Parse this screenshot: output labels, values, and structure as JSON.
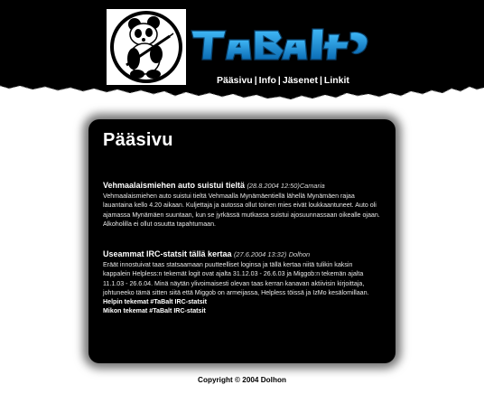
{
  "header": {
    "logo_text": "TaBalt",
    "nav": [
      {
        "label": "Pääsivu"
      },
      {
        "label": "Info"
      },
      {
        "label": "Jäsenet"
      },
      {
        "label": "Linkit"
      }
    ],
    "separator": "|"
  },
  "main": {
    "title": "Pääsivu",
    "posts": [
      {
        "title": "Vehmaalaismiehen auto suistui tieltä",
        "meta": "(28.8.2004 12:50)",
        "author": "Camaria",
        "body": "Vehmaalaismiehen auto suistui tieltä Vehmaalla Mynämäentiellä lähellä Mynämäen rajaa lauantaina kello 4.20 aikaan. Kuljettaja ja autossa ollut toinen mies eivät loukkaantuneet. Auto oli ajamassa Mynämäen suuntaan, kun se jyrkässä mutkassa suistui ajosuunnassaan oikealle ojaan. Alkoholilla ei ollut osuutta tapahtumaan.",
        "links": []
      },
      {
        "title": "Useammat IRC-statsit tällä kertaa",
        "meta": "(27.6.2004 13:32)",
        "author": "Dolhon",
        "body": "Eräät innostuivat taas statsaamaan puutteelliset loginsa ja tällä kertaa niitä tulikin kaksin kappalein Helpless:n tekemät logit ovat ajalta 31.12.03 - 26.6.03 ja Miggob:n tekemän ajalta 11.1.03 - 26.6.04. Minä näytän ylivoimaisesti olevan taas kerran kanavan aktiivisin kirjoittaja, johtuneeko tämä sitten siitä että Miggob on armeijassa, Helpless töissä ja IzMo kesälomillaan.",
        "links": [
          {
            "label": "Helpin tekemat #TaBalt IRC-statsit"
          },
          {
            "label": "Mikon tekemat #TaBalt IRC-statsit"
          }
        ]
      }
    ]
  },
  "footer": {
    "copyright": "Copyright © 2004 Dolhon"
  },
  "colors": {
    "header_band": "#000000",
    "logo_blue": "#1a8fd8",
    "panel": "#000000",
    "text": "#ffffff"
  }
}
